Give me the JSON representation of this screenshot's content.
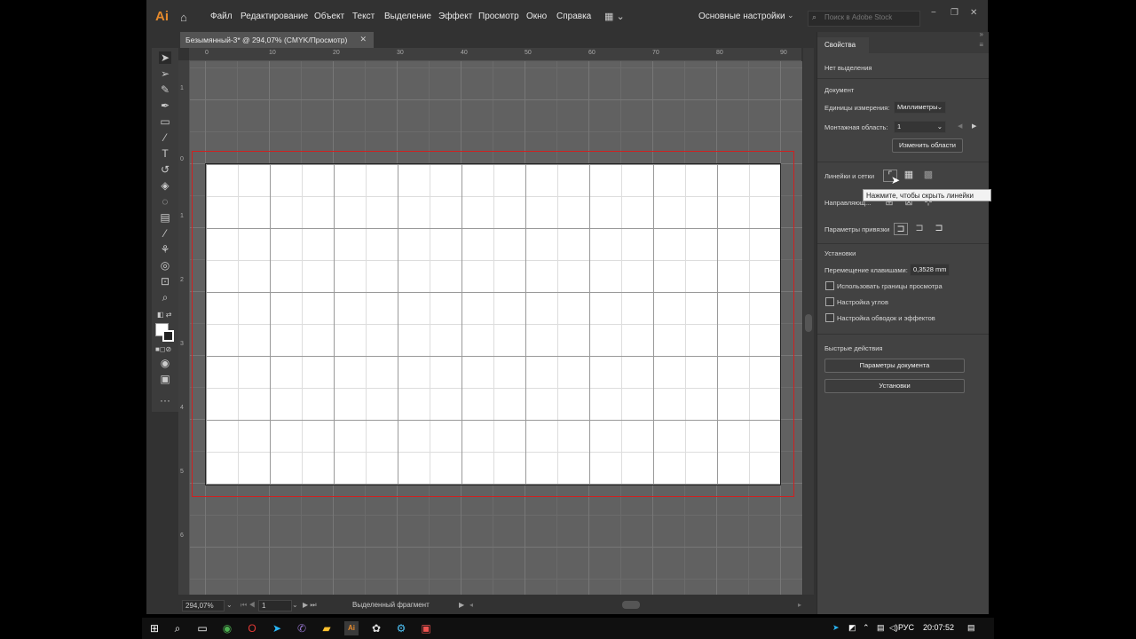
{
  "app": {
    "logo": "Ai",
    "menu": [
      "Файл",
      "Редактирование",
      "Объект",
      "Текст",
      "Выделение",
      "Эффект",
      "Просмотр",
      "Окно",
      "Справка"
    ],
    "workspace": "Основные настройки",
    "search_placeholder": "Поиск в Adobe Stock",
    "window_controls": [
      "−",
      "❐",
      "✕"
    ]
  },
  "document_tab": {
    "title": "Безымянный-3* @ 294,07% (CMYK/Просмотр)",
    "close": "✕"
  },
  "rulers": {
    "horizontal": [
      "0",
      "10",
      "20",
      "30",
      "40",
      "50",
      "60",
      "70",
      "80",
      "90"
    ],
    "vertical": [
      "1",
      "0",
      "1",
      "2",
      "3",
      "4",
      "5",
      "6"
    ]
  },
  "status_bar": {
    "zoom": "294,07%",
    "artboard": "1",
    "tool_label": "Выделенный фрагмент"
  },
  "properties_panel": {
    "tab": "Свойства",
    "no_selection": "Нет выделения",
    "document_section": "Документ",
    "units_label": "Единицы измерения:",
    "units_value": "Миллиметры",
    "artboard_label": "Монтажная область:",
    "artboard_value": "1",
    "edit_artboards": "Изменить области",
    "rulers_grids": "Линейки и сетки",
    "tooltip": "Нажмите, чтобы скрыть линейки",
    "guides": "Направляющ...",
    "snap_options": "Параметры привязки",
    "preferences_section": "Установки",
    "keyboard_increment_label": "Перемещение клавишами:",
    "keyboard_increment_value": "0,3528 mm",
    "checkboxes": [
      "Использовать границы просмотра",
      "Настройка углов",
      "Настройка обводок и эффектов"
    ],
    "quick_actions": "Быстрые действия",
    "document_setup": "Параметры документа",
    "preferences": "Установки"
  },
  "taskbar": {
    "language": "РУС",
    "time": "20:07:52"
  },
  "colors": {
    "app_bg": "#323232",
    "panel_bg": "#424242",
    "canvas_bg": "#616161",
    "bleed": "#d02020",
    "logo": "#e58a2c"
  }
}
